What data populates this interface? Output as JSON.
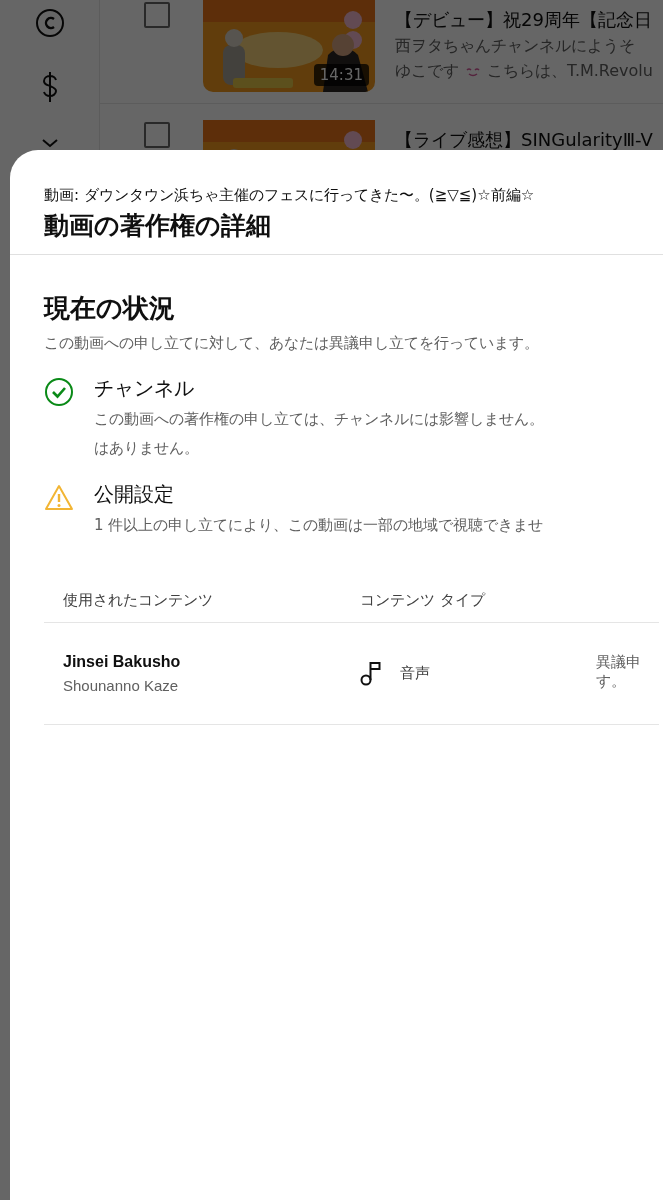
{
  "background_page": {
    "videos": [
      {
        "checked": false,
        "duration": "14:31",
        "title": "【デビュー】祝29周年【記念日",
        "description_lines": [
          [
            "西ヲタちゃんチャンネルにようそ"
          ],
          [
            "ゆこです",
            "こちらは、T.M.Revolu"
          ]
        ]
      },
      {
        "checked": false,
        "title": "【ライブ感想】SINGularityⅢ-V"
      }
    ]
  },
  "dialog": {
    "subtitle": "動画: ダウンタウン浜ちゃ主催のフェスに行ってきた〜。(≧▽≦)☆前編☆",
    "title": "動画の著作権の詳細",
    "status": {
      "heading": "現在の状況",
      "description": "この動画への申し立てに対して、あなたは異議申し立てを行っています。",
      "items": [
        {
          "kind": "ok",
          "title": "チャンネル",
          "lines": [
            "この動画への著作権の申し立ては、チャンネルには影響しません。",
            "はありません。"
          ]
        },
        {
          "kind": "warning",
          "title": "公開設定",
          "lines": [
            "1 件以上の申し立てにより、この動画は一部の地域で視聴できませ"
          ]
        }
      ]
    },
    "table": {
      "columns": [
        "使用されたコンテンツ",
        "コンテンツ タイプ"
      ],
      "rows": [
        {
          "title": "Jinsei Bakusho",
          "artist": "Shounanno Kaze",
          "content_type": "音声",
          "column_3": [
            "異議申",
            "す。"
          ]
        }
      ]
    }
  }
}
